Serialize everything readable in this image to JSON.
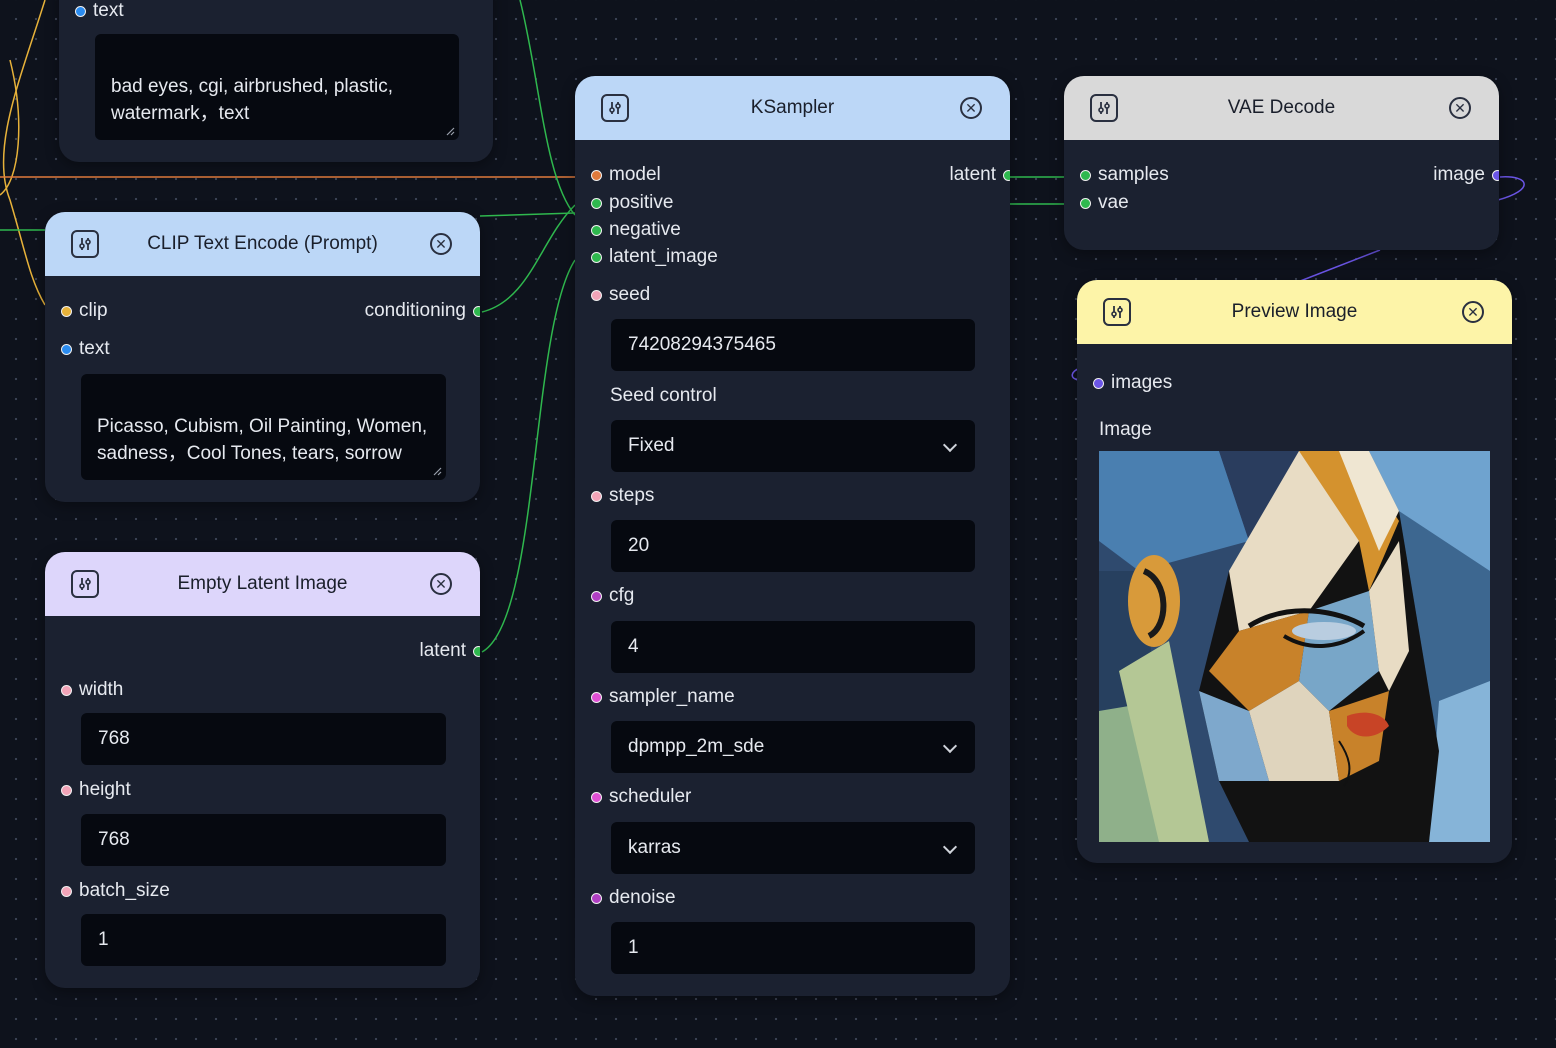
{
  "colors": {
    "canvas": "#0e121c",
    "node_body": "#1b2130",
    "clip_header": "#bcd7f7",
    "latent_header": "#ddd6fb",
    "vae_header": "#d9d9d9",
    "preview_header": "#fdf4a8",
    "wire_green": "#2fb84e",
    "wire_orange": "#e07a3c",
    "wire_yellow": "#e7b23a",
    "wire_purple": "#6b55e6"
  },
  "negative_prompt_node": {
    "text_port": "text",
    "text_value": "bad eyes, cgi, airbrushed, plastic, watermark，text"
  },
  "clip_node": {
    "title": "CLIP Text Encode (Prompt)",
    "inputs": [
      "clip",
      "text"
    ],
    "output": "conditioning",
    "text_value": "Picasso, Cubism, Oil Painting, Women, sadness，Cool Tones, tears, sorrow"
  },
  "latent_node": {
    "title": "Empty Latent Image",
    "output": "latent",
    "width_label": "width",
    "width_value": "768",
    "height_label": "height",
    "height_value": "768",
    "batch_label": "batch_size",
    "batch_value": "1"
  },
  "ksampler_node": {
    "title": "KSampler",
    "inputs": [
      "model",
      "positive",
      "negative",
      "latent_image"
    ],
    "output": "latent",
    "seed_label": "seed",
    "seed_value": "74208294375465",
    "seed_control_label": "Seed control",
    "seed_control_value": "Fixed",
    "steps_label": "steps",
    "steps_value": "20",
    "cfg_label": "cfg",
    "cfg_value": "4",
    "sampler_label": "sampler_name",
    "sampler_value": "dpmpp_2m_sde",
    "scheduler_label": "scheduler",
    "scheduler_value": "karras",
    "denoise_label": "denoise",
    "denoise_value": "1"
  },
  "vae_node": {
    "title": "VAE Decode",
    "inputs": [
      "samples",
      "vae"
    ],
    "output": "image"
  },
  "preview_node": {
    "title": "Preview Image",
    "input": "images",
    "image_label": "Image"
  },
  "icons": {
    "node_icon": "sliders-icon",
    "close_icon": "close-circle-icon",
    "dropdown_icon": "chevron-down-icon"
  }
}
